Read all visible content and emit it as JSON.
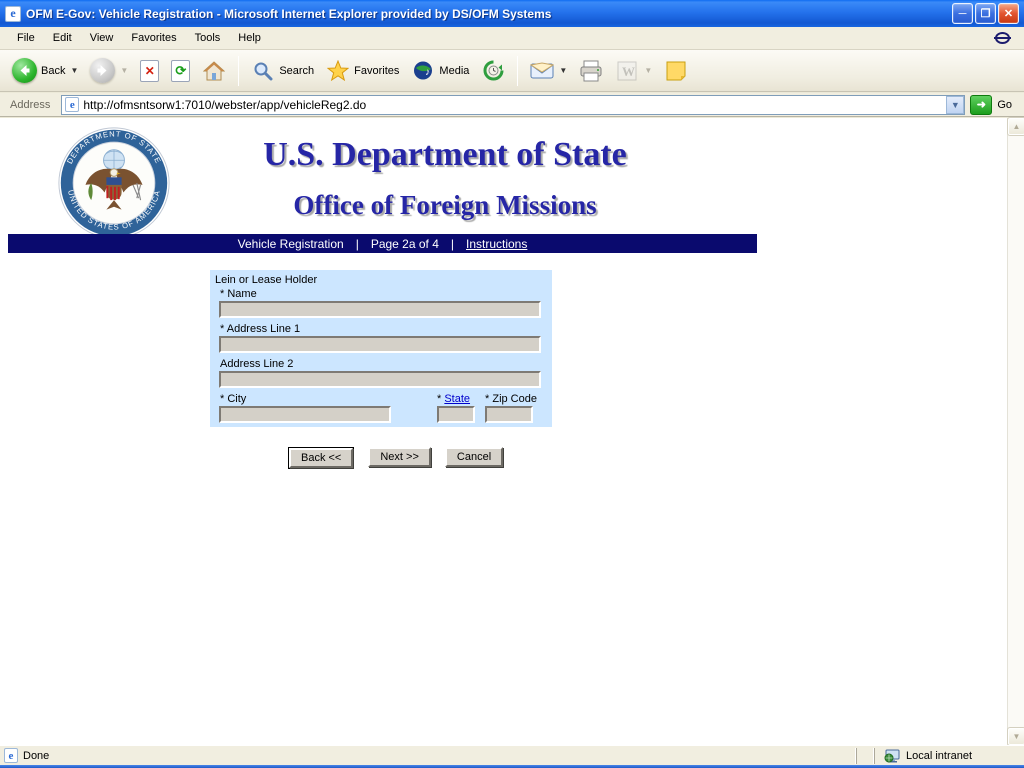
{
  "window": {
    "title": "OFM E-Gov: Vehicle Registration - Microsoft Internet Explorer provided by DS/OFM Systems"
  },
  "menu_bar": {
    "items": [
      "File",
      "Edit",
      "View",
      "Favorites",
      "Tools",
      "Help"
    ]
  },
  "toolbar": {
    "back_label": "Back",
    "search_label": "Search",
    "favorites_label": "Favorites",
    "media_label": "Media",
    "word_glyph": "W"
  },
  "address_bar": {
    "label": "Address",
    "url": "http://ofmsntsorw1:7010/webster/app/vehicleReg2.do",
    "go_label": "Go"
  },
  "header": {
    "title": "U.S. Department of State",
    "subtitle": "Office of Foreign Missions",
    "seal_top_text": "DEPARTMENT OF STATE",
    "seal_bottom_text": "UNITED STATES OF AMERICA"
  },
  "nav_bar": {
    "item1": "Vehicle Registration",
    "separator": "|",
    "item2": "Page 2a of 4",
    "item3": "Instructions"
  },
  "form": {
    "section_title": "Lein or Lease Holder",
    "fields": {
      "name": {
        "required": "*",
        "label": "Name",
        "value": ""
      },
      "address1": {
        "required": "*",
        "label": "Address Line 1",
        "value": ""
      },
      "address2": {
        "required": "",
        "label": "Address Line 2",
        "value": ""
      },
      "city": {
        "required": "*",
        "label": "City",
        "value": ""
      },
      "state": {
        "required": "*",
        "label": "State",
        "value": ""
      },
      "zip": {
        "required": "*",
        "label": "Zip Code",
        "value": ""
      }
    }
  },
  "buttons": {
    "back": "Back <<",
    "next": "Next >>",
    "cancel": "Cancel"
  },
  "status_bar": {
    "left": "Done",
    "right": "Local intranet"
  },
  "colors": {
    "navy_strip": "#0a0a6e",
    "panel_blue": "#cce6ff",
    "title_blue": "#2626a6"
  }
}
